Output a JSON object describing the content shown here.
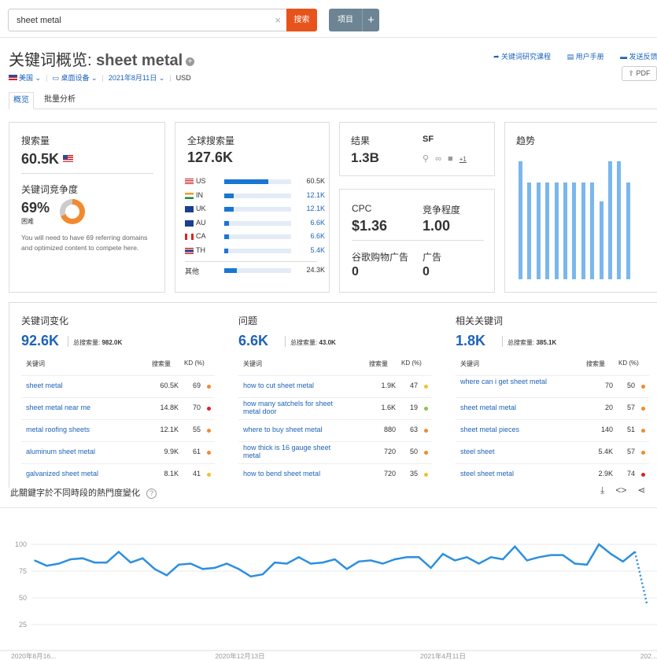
{
  "search": {
    "value": "sheet metal",
    "button": "搜索",
    "clear": "×"
  },
  "project_button": {
    "label": "项目",
    "plus": "+"
  },
  "header": {
    "title_prefix": "关键词概览: ",
    "keyword": "sheet metal",
    "links": [
      "关键词研究课程",
      "用户手册",
      "发送反馈"
    ],
    "pdf": "PDF"
  },
  "filters": {
    "country": "美国",
    "device": "桌面设备",
    "date": "2021年8月11日",
    "currency": "USD"
  },
  "tabs": [
    "概览",
    "批量分析"
  ],
  "volume_card": {
    "label": "搜索量",
    "value": "60.5K",
    "kd_label": "关键词竞争度",
    "kd_value": "69%",
    "kd_level": "困难",
    "kd_percent": 69,
    "note": "You will need to have 69 referring domains and optimized content to compete here."
  },
  "global_card": {
    "label": "全球搜索量",
    "value": "127.6K",
    "countries": [
      {
        "code": "US",
        "value": "60.5K",
        "share": 0.47,
        "linked": false
      },
      {
        "code": "IN",
        "value": "12.1K",
        "share": 0.1,
        "linked": true
      },
      {
        "code": "UK",
        "value": "12.1K",
        "share": 0.1,
        "linked": true
      },
      {
        "code": "AU",
        "value": "6.6K",
        "share": 0.05,
        "linked": true
      },
      {
        "code": "CA",
        "value": "6.6K",
        "share": 0.05,
        "linked": true
      },
      {
        "code": "TH",
        "value": "5.4K",
        "share": 0.04,
        "linked": true
      }
    ],
    "other_label": "其他",
    "other_value": "24.3K",
    "other_share": 0.19
  },
  "results_card": {
    "label": "结果",
    "value": "1.3B",
    "sf_label": "SF",
    "sf_more": "+1"
  },
  "cpc_card": {
    "cpc_label": "CPC",
    "cpc_value": "$1.36",
    "comp_label": "竞争程度",
    "comp_value": "1.00",
    "shopping_label": "谷歌购物广告",
    "shopping_value": "0",
    "ads_label": "广告",
    "ads_value": "0"
  },
  "trend_card": {
    "label": "趋势",
    "values": [
      1.0,
      0.82,
      0.82,
      0.82,
      0.82,
      0.82,
      0.82,
      0.82,
      0.82,
      0.66,
      1.0,
      1.0,
      0.82
    ]
  },
  "sections": [
    {
      "title": "关键词变化",
      "count": "92.6K",
      "total_label": "总搜索量:",
      "total": "982.0K",
      "headers": [
        "关键词",
        "搜索量",
        "KD (%)"
      ],
      "rows": [
        {
          "kw": "sheet metal",
          "vol": "60.5K",
          "kd": "69",
          "color": "#f28a2d"
        },
        {
          "kw": "sheet metal near me",
          "vol": "14.8K",
          "kd": "70",
          "color": "#d9232d"
        },
        {
          "kw": "metal roofing sheets",
          "vol": "12.1K",
          "kd": "55",
          "color": "#f28a2d"
        },
        {
          "kw": "aluminum sheet metal",
          "vol": "9.9K",
          "kd": "61",
          "color": "#f28a2d"
        },
        {
          "kw": "galvanized sheet metal",
          "vol": "8.1K",
          "kd": "41",
          "color": "#f2c12e"
        }
      ]
    },
    {
      "title": "问题",
      "count": "6.6K",
      "total_label": "总搜索量:",
      "total": "43.0K",
      "headers": [
        "关键词",
        "搜索量",
        "KD (%)"
      ],
      "rows": [
        {
          "kw": "how to cut sheet metal",
          "vol": "1.9K",
          "kd": "47",
          "color": "#f2c12e"
        },
        {
          "kw": "how many satchels for sheet metal door",
          "vol": "1.6K",
          "kd": "19",
          "color": "#8bc34a"
        },
        {
          "kw": "where to buy sheet metal",
          "vol": "880",
          "kd": "63",
          "color": "#f28a2d"
        },
        {
          "kw": "how thick is 16 gauge sheet metal",
          "vol": "720",
          "kd": "50",
          "color": "#f28a2d"
        },
        {
          "kw": "how to bend sheet metal",
          "vol": "720",
          "kd": "35",
          "color": "#f2c12e"
        }
      ]
    },
    {
      "title": "相关关键词",
      "count": "1.8K",
      "total_label": "总搜索量:",
      "total": "385.1K",
      "headers": [
        "关键词",
        "搜索量",
        "KD (%)"
      ],
      "rows": [
        {
          "kw": "where can i get sheet metal",
          "vol": "70",
          "kd": "50",
          "color": "#f28a2d"
        },
        {
          "kw": "sheet metal metal",
          "vol": "20",
          "kd": "57",
          "color": "#f28a2d"
        },
        {
          "kw": "sheet metal pieces",
          "vol": "140",
          "kd": "51",
          "color": "#f28a2d"
        },
        {
          "kw": "steel sheet",
          "vol": "5.4K",
          "kd": "57",
          "color": "#f28a2d"
        },
        {
          "kw": "steel sheet metal",
          "vol": "2.9K",
          "kd": "74",
          "color": "#d9232d"
        }
      ]
    }
  ],
  "interest_chart": {
    "title": "此關鍵字於不同時段的熱門度變化",
    "help": "?",
    "y_ticks": [
      "100",
      "75",
      "50",
      "25"
    ],
    "x_labels": [
      "2020年8月16...",
      "2020年12月13日",
      "2021年4月11日",
      "202..."
    ]
  },
  "chart_data": {
    "type": "line",
    "ylim": [
      0,
      100
    ],
    "y_ticks": [
      25,
      50,
      75,
      100
    ],
    "x_labels": [
      "2020年8月16...",
      "2020年12月13日",
      "2021年4月11日",
      "202..."
    ],
    "series": [
      {
        "values": [
          85,
          80,
          82,
          86,
          87,
          83,
          83,
          93,
          83,
          87,
          77,
          71,
          81,
          82,
          77,
          78,
          82,
          77,
          70,
          72,
          83,
          82,
          88,
          82,
          83,
          86,
          77,
          84,
          85,
          82,
          86,
          88,
          88,
          78,
          91,
          85,
          88,
          82,
          88,
          86,
          98,
          85,
          88,
          90,
          90,
          82,
          81,
          100,
          91,
          84,
          93
        ]
      },
      {
        "style": "dotted",
        "values": [
          93,
          45
        ]
      }
    ]
  }
}
